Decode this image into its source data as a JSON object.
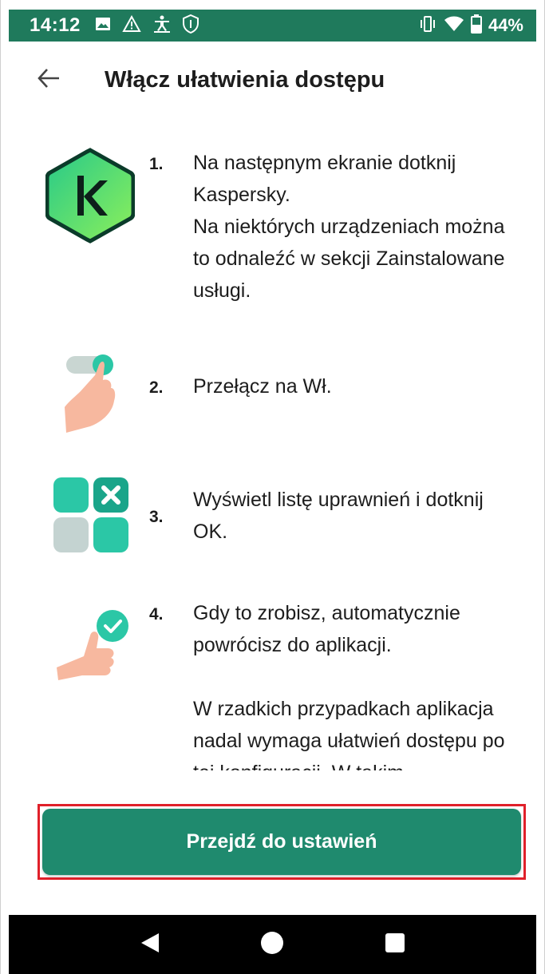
{
  "status_bar": {
    "time": "14:12",
    "battery_percent": "44%",
    "color": "#1f7a5c",
    "icons_left": [
      "image-icon",
      "warning-icon",
      "accessibility-person-icon",
      "shield-icon"
    ],
    "icons_right": [
      "vibrate-icon",
      "wifi-icon",
      "battery-icon"
    ]
  },
  "app_bar": {
    "title": "Włącz ułatwienia dostępu",
    "back_icon": "arrow-left-icon"
  },
  "steps": [
    {
      "number": "1.",
      "icon": "kaspersky-logo-icon",
      "lines": [
        "Na następnym ekranie dotknij Kaspersky.",
        "Na niektórych urządzeniach można to odnaleźć w sekcji Zainstalowane usługi."
      ]
    },
    {
      "number": "2.",
      "icon": "toggle-hand-icon",
      "lines": [
        "Przełącz na Wł."
      ]
    },
    {
      "number": "3.",
      "icon": "app-grid-icon",
      "lines": [
        "Wyświetl listę uprawnień i dotknij OK."
      ]
    },
    {
      "number": "4.",
      "icon": "thumbs-up-check-icon",
      "lines": [
        "Gdy to zrobisz, automatycznie powrócisz do aplikacji.",
        "W rzadkich przypadkach aplikacja nadal wymaga ułatwień dostępu po tej konfiguracji. W takim"
      ]
    }
  ],
  "cta": {
    "label": "Przejdź do ustawień",
    "color": "#1f8a6e",
    "highlight_color": "#e0202a"
  },
  "nav_bar": {
    "icons": [
      "back-triangle-icon",
      "home-circle-icon",
      "recents-square-icon"
    ]
  }
}
